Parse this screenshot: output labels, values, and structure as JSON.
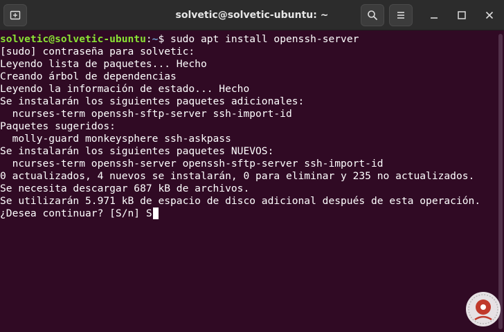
{
  "window": {
    "title": "solvetic@solvetic-ubuntu: ~",
    "new_tab_icon": "new-tab-icon",
    "search_icon": "search-icon",
    "menu_icon": "hamburger-menu-icon",
    "minimize_icon": "minimize-icon",
    "maximize_icon": "maximize-icon",
    "close_icon": "close-icon"
  },
  "terminal": {
    "prompt_user": "solvetic@solvetic-ubuntu",
    "prompt_sep": ":",
    "prompt_path": "~",
    "prompt_symbol": "$ ",
    "command": "sudo apt install openssh-server",
    "output": [
      "[sudo] contraseña para solvetic:",
      "Leyendo lista de paquetes... Hecho",
      "Creando árbol de dependencias",
      "Leyendo la información de estado... Hecho",
      "Se instalarán los siguientes paquetes adicionales:",
      "  ncurses-term openssh-sftp-server ssh-import-id",
      "Paquetes sugeridos:",
      "  molly-guard monkeysphere ssh-askpass",
      "Se instalarán los siguientes paquetes NUEVOS:",
      "  ncurses-term openssh-server openssh-sftp-server ssh-import-id",
      "0 actualizados, 4 nuevos se instalarán, 0 para eliminar y 235 no actualizados.",
      "Se necesita descargar 687 kB de archivos.",
      "Se utilizarán 5.971 kB de espacio de disco adicional después de esta operación.",
      "¿Desea continuar? [S/n] S"
    ]
  },
  "colors": {
    "background": "#300a24",
    "prompt_user": "#8ae234",
    "prompt_path": "#729fcf",
    "text": "#ffffff",
    "titlebar": "#2c2c2c"
  }
}
